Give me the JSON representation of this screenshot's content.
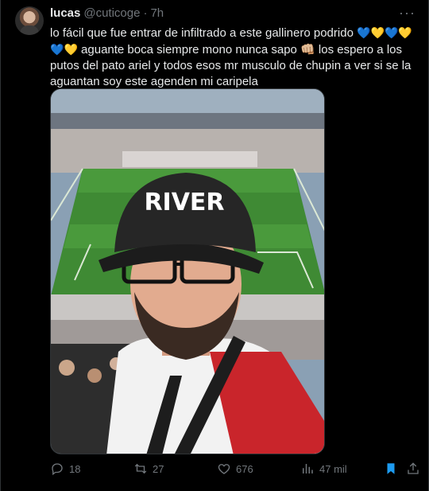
{
  "tweet": {
    "author_name": "lucas",
    "author_handle": "@cuticoge",
    "separator": "·",
    "time": "7h",
    "more_label": "···",
    "text_part1": "lo fácil que fue entrar de infiltrado a este gallinero podrido ",
    "hearts1": [
      "💙",
      "💛",
      "💙",
      "💛",
      "💙",
      "💛"
    ],
    "text_part2": " aguante boca siempre mono nunca sapo ",
    "fist": "👊🏼",
    "text_part3": " los espero a los putos del pato ariel y todos esos mr musculo de chupin a ver si se la aguantan soy este agenden mi caripela",
    "image_hat_text": "RIVER"
  },
  "actions": {
    "replies": "18",
    "retweets": "27",
    "likes": "676",
    "views": "47 mil"
  },
  "colors": {
    "background": "#000000",
    "text": "#e7e9ea",
    "muted": "#71767b",
    "bookmark_active": "#1d9bf0"
  }
}
